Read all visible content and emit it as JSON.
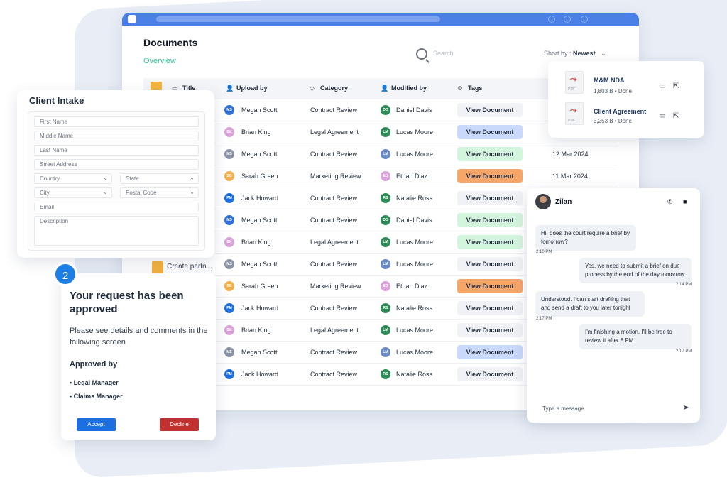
{
  "documents": {
    "title": "Documents",
    "subtitle": "Overview",
    "search_placeholder": "Search",
    "sort_label": "Short by :",
    "sort_value": "Newest",
    "columns": {
      "title": "Title",
      "upload_by": "Upload by",
      "category": "Category",
      "modified_by": "Modified by",
      "tags": "Tags"
    },
    "view_label": "View Document",
    "create_label": "Create partn...",
    "rows": [
      {
        "uploader": "Megan Scott",
        "u_init": "MS",
        "u_color": "#2f6fd6",
        "category": "Contract Review",
        "modifier": "Daniel Davis",
        "m_init": "DD",
        "m_color": "#2e8b57",
        "tag": "grey",
        "date": ""
      },
      {
        "uploader": "Brian King",
        "u_init": "BK",
        "u_color": "#d9a2d8",
        "category": "Legal Agreement",
        "modifier": "Lucas Moore",
        "m_init": "LM",
        "m_color": "#2e8b57",
        "tag": "blue",
        "date": ""
      },
      {
        "uploader": "Megan Scott",
        "u_init": "MS",
        "u_color": "#8a94a6",
        "category": "Contract Review",
        "modifier": "Lucas Moore",
        "m_init": "LM",
        "m_color": "#6a88c4",
        "tag": "green",
        "date": "12 Mar 2024"
      },
      {
        "uploader": "Sarah Green",
        "u_init": "SG",
        "u_color": "#f2b04a",
        "category": "Marketing Review",
        "modifier": "Ethan Diaz",
        "m_init": "ED",
        "m_color": "#d9a2d8",
        "tag": "orange",
        "date": "11 Mar 2024"
      },
      {
        "uploader": "Jack Howard",
        "u_init": "PM",
        "u_color": "#1d6ee0",
        "category": "Contract Review",
        "modifier": "Natalie Ross",
        "m_init": "RS",
        "m_color": "#2e8b57",
        "tag": "grey",
        "date": ""
      },
      {
        "uploader": "Megan Scott",
        "u_init": "MS",
        "u_color": "#2f6fd6",
        "category": "Contract Review",
        "modifier": "Daniel Davis",
        "m_init": "DD",
        "m_color": "#2e8b57",
        "tag": "green",
        "date": ""
      },
      {
        "uploader": "Brian King",
        "u_init": "BK",
        "u_color": "#d9a2d8",
        "category": "Legal Agreement",
        "modifier": "Lucas Moore",
        "m_init": "LM",
        "m_color": "#2e8b57",
        "tag": "green",
        "date": ""
      },
      {
        "uploader": "Megan Scott",
        "u_init": "MS",
        "u_color": "#8a94a6",
        "category": "Contract Review",
        "modifier": "Lucas Moore",
        "m_init": "LM",
        "m_color": "#6a88c4",
        "tag": "grey",
        "date": ""
      },
      {
        "uploader": "Sarah Green",
        "u_init": "SG",
        "u_color": "#f2b04a",
        "category": "Marketing Review",
        "modifier": "Ethan Diaz",
        "m_init": "ED",
        "m_color": "#d9a2d8",
        "tag": "orange",
        "date": ""
      },
      {
        "uploader": "Jack Howard",
        "u_init": "PM",
        "u_color": "#1d6ee0",
        "category": "Contract Review",
        "modifier": "Natalie Ross",
        "m_init": "RS",
        "m_color": "#2e8b57",
        "tag": "grey",
        "date": ""
      },
      {
        "uploader": "Brian King",
        "u_init": "BK",
        "u_color": "#d9a2d8",
        "category": "Legal Agreement",
        "modifier": "Lucas Moore",
        "m_init": "LM",
        "m_color": "#2e8b57",
        "tag": "grey",
        "date": ""
      },
      {
        "uploader": "Megan Scott",
        "u_init": "MS",
        "u_color": "#8a94a6",
        "category": "Contract Review",
        "modifier": "Lucas Moore",
        "m_init": "LM",
        "m_color": "#6a88c4",
        "tag": "blue",
        "date": ""
      },
      {
        "uploader": "Jack Howard",
        "u_init": "PM",
        "u_color": "#1d6ee0",
        "category": "Contract Review",
        "modifier": "Natalie Ross",
        "m_init": "RS",
        "m_color": "#2e8b57",
        "tag": "grey",
        "date": ""
      }
    ]
  },
  "intake": {
    "title": "Client Intake",
    "fields": {
      "first_name": "First Name",
      "middle_name": "Middle Name",
      "last_name": "Last Name",
      "street": "Street Address",
      "country": "Country",
      "state": "State",
      "city": "City",
      "postal": "Postal Code",
      "email": "Email",
      "description": "Description"
    }
  },
  "approval": {
    "step": "2",
    "title": "Your request has been approved",
    "desc": "Please see details and comments in the following screen",
    "approved_by": "Approved by",
    "approvers": [
      "• Legal Manager",
      "• Claims Manager"
    ],
    "accept": "Accept",
    "decline": "Decline"
  },
  "files": [
    {
      "name": "M&M NDA",
      "meta": "1,803 B • Done"
    },
    {
      "name": "Client Agreement",
      "meta": "3,253 B • Done"
    }
  ],
  "pdf_label": "PDF",
  "chat": {
    "name": "Zilan",
    "messages": [
      {
        "text": "Hi, does the court require a brief by tomorrow?",
        "time": "2:10 PM"
      },
      {
        "text": "Yes, we need to submit a brief on due process by the end of the day tomorrow",
        "time": "2:14 PM"
      },
      {
        "text": "Understood. I can start drafting that and send a draft to you later tonight",
        "time": "2:17 PM"
      },
      {
        "text": "I'm finishing a motion. I'll be free to review it after 8 PM",
        "time": "2:17 PM"
      }
    ],
    "input_placeholder": "Type a message"
  },
  "colors": {
    "accent_blue": "#1d6ee0",
    "green_text": "#34c29a",
    "decline_red": "#c0312f"
  }
}
